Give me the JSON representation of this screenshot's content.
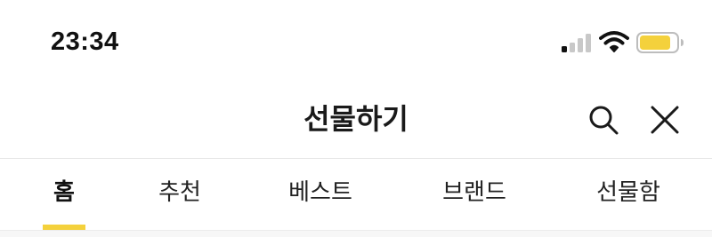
{
  "status_bar": {
    "time": "23:34",
    "signal_icon": "cellular-signal-icon",
    "wifi_icon": "wifi-icon",
    "battery_icon": "battery-icon",
    "battery_color": "#f4d13c"
  },
  "header": {
    "title": "선물하기",
    "search_icon": "search-icon",
    "close_icon": "close-icon"
  },
  "tabs": [
    {
      "label": "홈",
      "active": true
    },
    {
      "label": "추천",
      "active": false
    },
    {
      "label": "베스트",
      "active": false
    },
    {
      "label": "브랜드",
      "active": false
    },
    {
      "label": "선물함",
      "active": false
    }
  ],
  "colors": {
    "accent": "#f4d13c",
    "text": "#1a1a1a",
    "divider": "#e6e6e6"
  }
}
